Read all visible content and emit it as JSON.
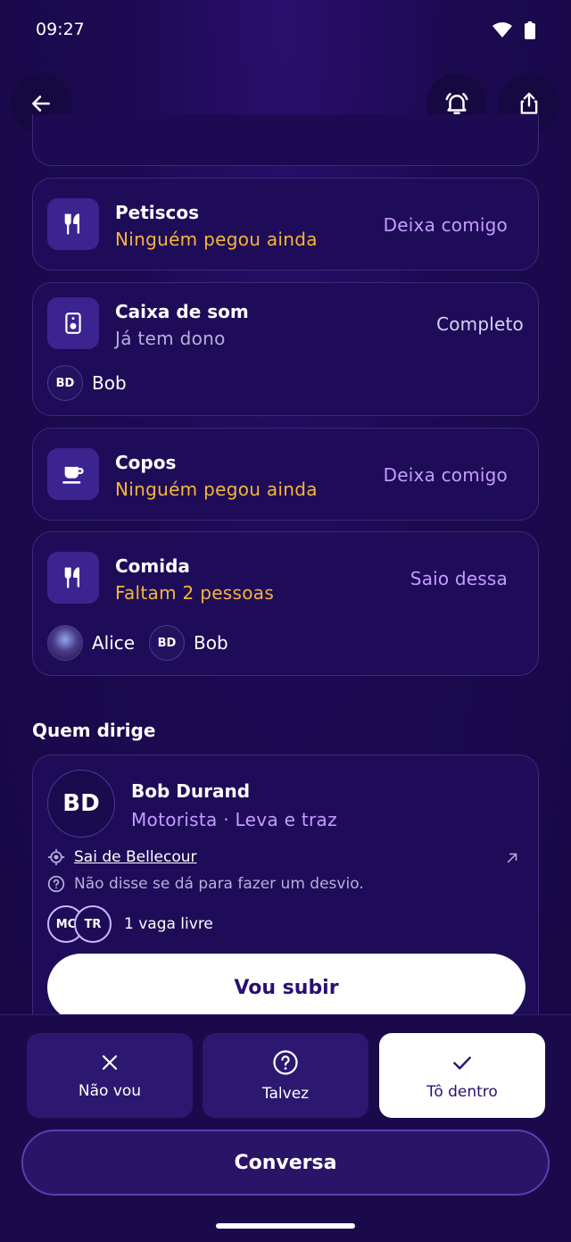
{
  "status_bar": {
    "time": "09:27"
  },
  "header": {
    "back_icon": "arrow-left-icon",
    "alarm_icon": "bell-ring-icon",
    "share_icon": "share-icon"
  },
  "items": [
    {
      "title": "Petiscos",
      "status": "Ninguém pegou ainda",
      "action": "Deixa comigo",
      "icon": "fork-knife-icon"
    },
    {
      "title": "Caixa de som",
      "status": "Já tem dono",
      "action": "Completo",
      "icon": "speaker-icon",
      "people": [
        {
          "initials": "BD",
          "name": "Bob"
        }
      ]
    },
    {
      "title": "Copos",
      "status": "Ninguém pegou ainda",
      "action": "Deixa comigo",
      "icon": "cup-icon"
    },
    {
      "title": "Comida",
      "status": "Faltam 2 pessoas",
      "action": "Saio dessa",
      "icon": "fork-knife-icon",
      "people": [
        {
          "name": "Alice"
        },
        {
          "initials": "BD",
          "name": "Bob"
        }
      ]
    }
  ],
  "drivers": {
    "section_title": "Quem dirige",
    "card": {
      "initials": "BD",
      "name": "Bob Durand",
      "role": "Motorista · Leva e traz",
      "departure": "Sai de Bellecour",
      "detour": "Não disse se dá para fazer um desvio.",
      "passengers": [
        "MC",
        "TR"
      ],
      "seats": "1 vaga livre",
      "join_label": "Vou subir"
    }
  },
  "rsvp": {
    "options": [
      {
        "label": "Não vou",
        "icon": "close-icon"
      },
      {
        "label": "Talvez",
        "icon": "question-circle-icon"
      },
      {
        "label": "Tô dentro",
        "icon": "check-icon"
      }
    ],
    "selected": "Tô dentro"
  },
  "chat_button": "Conversa",
  "colors": {
    "accent_purple": "#c59cff",
    "warning_orange": "#f5b63a",
    "background": "#1c0a52"
  }
}
